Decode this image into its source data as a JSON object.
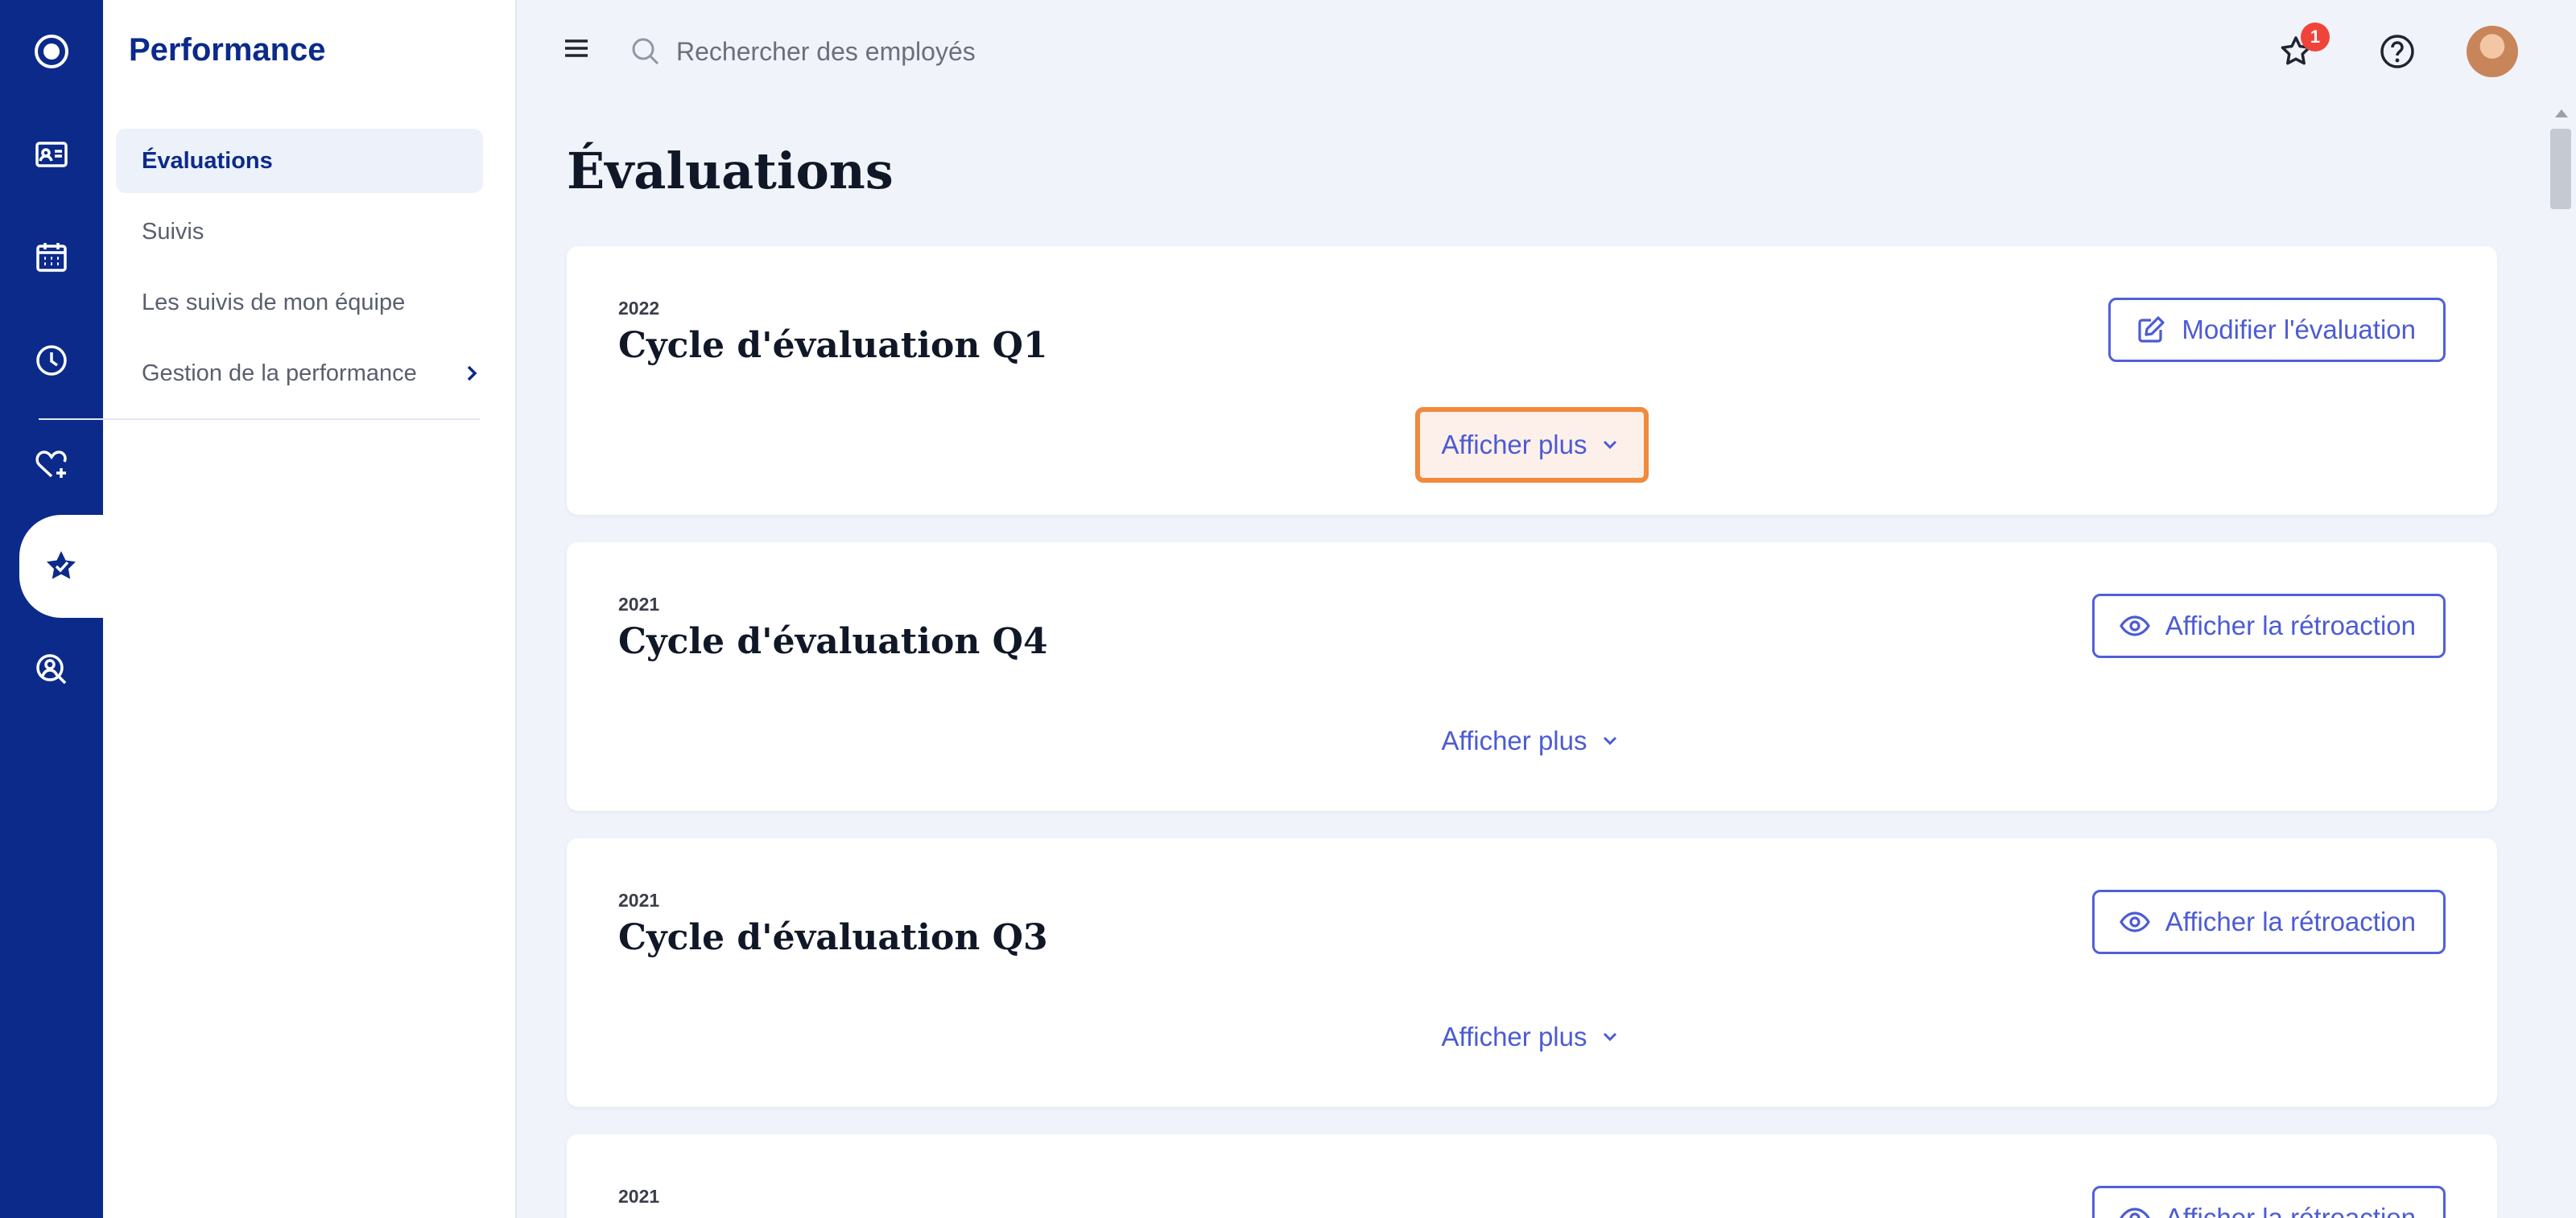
{
  "rail": {
    "items": [
      {
        "icon": "app-logo-icon"
      },
      {
        "icon": "id-card-icon"
      },
      {
        "icon": "calendar-icon"
      },
      {
        "icon": "clock-icon"
      },
      {
        "icon": "heart-plus-icon"
      },
      {
        "icon": "star-check-icon",
        "active": true
      },
      {
        "icon": "person-search-icon"
      }
    ]
  },
  "subnav": {
    "title": "Performance",
    "items": [
      {
        "label": "Évaluations",
        "active": true
      },
      {
        "label": "Suivis"
      },
      {
        "label": "Les suivis de mon équipe"
      },
      {
        "label": "Gestion de la performance",
        "has_submenu": true
      }
    ]
  },
  "topbar": {
    "search_placeholder": "Rechercher des employés",
    "notification_count": "1"
  },
  "page": {
    "title": "Évaluations",
    "cards": [
      {
        "year": "2022",
        "title": "Cycle d'évaluation Q1",
        "action": "Modifier l'évaluation",
        "action_icon": "edit-icon",
        "show_more": "Afficher plus"
      },
      {
        "year": "2021",
        "title": "Cycle d'évaluation Q4",
        "action": "Afficher la rétroaction",
        "action_icon": "eye-icon",
        "show_more": "Afficher plus"
      },
      {
        "year": "2021",
        "title": "Cycle d'évaluation Q3",
        "action": "Afficher la rétroaction",
        "action_icon": "eye-icon",
        "show_more": "Afficher plus"
      },
      {
        "year": "2021",
        "action": "Afficher la rétroaction",
        "action_icon": "eye-icon"
      }
    ]
  },
  "colors": {
    "rail": "#0b2a8a",
    "accent": "#4c5bd4",
    "focus": "#f08a3c",
    "badge": "#f0443a"
  }
}
